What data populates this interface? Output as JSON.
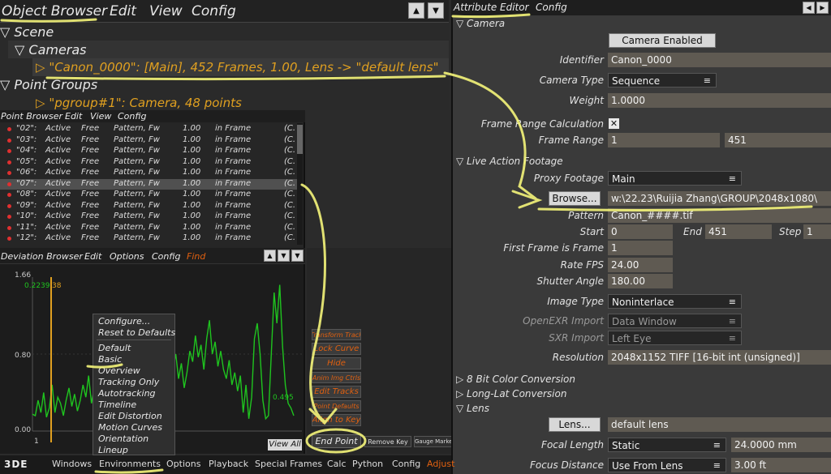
{
  "object_browser": {
    "menu": [
      "Object Browser",
      "Edit",
      "View",
      "Config"
    ],
    "scene": "Scene",
    "cameras": "Cameras",
    "camera_item": "\"Canon_0000\":  [Main], 452 Frames, 1.00, Lens -> \"default lens\"",
    "point_groups": "Point Groups",
    "pgroup_item": "\"pgroup#1\":  Camera, 48 points",
    "up": "▲",
    "down": "▼"
  },
  "point_browser": {
    "menu": [
      "Point Browser",
      "Edit",
      "View",
      "Config"
    ],
    "rows": [
      [
        "\"02\":",
        "Active",
        "Free",
        "Pattern, Fw",
        "1.00",
        "in Frame",
        "(C."
      ],
      [
        "\"03\":",
        "Active",
        "Free",
        "Pattern, Fw",
        "1.00",
        "in Frame",
        "(C."
      ],
      [
        "\"04\":",
        "Active",
        "Free",
        "Pattern, Fw",
        "1.00",
        "in Frame",
        "(C."
      ],
      [
        "\"05\":",
        "Active",
        "Free",
        "Pattern, Fw",
        "1.00",
        "in Frame",
        "(C."
      ],
      [
        "\"06\":",
        "Active",
        "Free",
        "Pattern, Fw",
        "1.00",
        "in Frame",
        "(C."
      ],
      [
        "\"07\":",
        "Active",
        "Free",
        "Pattern, Fw",
        "1.00",
        "in Frame",
        "(C."
      ],
      [
        "\"08\":",
        "Active",
        "Free",
        "Pattern, Fw",
        "1.00",
        "in Frame",
        "(C."
      ],
      [
        "\"09\":",
        "Active",
        "Free",
        "Pattern, Fw",
        "1.00",
        "in Frame",
        "(C."
      ],
      [
        "\"10\":",
        "Active",
        "Free",
        "Pattern, Fw",
        "1.00",
        "in Frame",
        "(C."
      ],
      [
        "\"11\":",
        "Active",
        "Free",
        "Pattern, Fw",
        "1.00",
        "in Frame",
        "(C."
      ],
      [
        "\"12\":",
        "Active",
        "Free",
        "Pattern, Fw",
        "1.00",
        "in Frame",
        "(C."
      ]
    ],
    "selected_row": 5
  },
  "deviation_browser": {
    "menu": [
      "Deviation Browser",
      "Edit",
      "Options",
      "Config",
      "Find"
    ],
    "ytop": "1.66",
    "ymid": "0.80",
    "ybot": "0.00",
    "xstart": "1",
    "cursor_value": "0.2239",
    "cursor_frame": "38",
    "right_value": "0.495",
    "view_all": "View All",
    "context_menu": [
      "Configure...",
      "Reset to Defaults",
      "Default",
      "Basic",
      "Overview",
      "Tracking Only",
      "Autotracking",
      "Timeline",
      "Edit Distortion",
      "Motion Curves",
      "Orientation",
      "Lineup"
    ],
    "side_buttons": [
      "Transform Track",
      "Lock Curve",
      "Hide",
      "Anim Img Ctrls",
      "Edit Tracks",
      "Point Defaults",
      "Align to Key"
    ],
    "end_point": "End Point",
    "remove_key": "Remove Key",
    "gauge_marker": "Gauge Marker",
    "curve": [
      0.11,
      0.1,
      0.2,
      0.12,
      0.25,
      0.09,
      0.15,
      0.3,
      0.12,
      0.22,
      0.18,
      0.1,
      0.2,
      0.28,
      0.16,
      0.24,
      0.13,
      0.2,
      0.3,
      0.22,
      0.36,
      0.18,
      0.28,
      0.4,
      0.26,
      0.48,
      0.3,
      0.55,
      0.38,
      0.6,
      0.35,
      0.5,
      0.42,
      0.65,
      0.44,
      0.56,
      0.36,
      0.6,
      0.4,
      0.5,
      0.7,
      0.45,
      0.52,
      0.38,
      0.55,
      0.42,
      0.3,
      0.45,
      0.35,
      0.26,
      0.4,
      0.5,
      0.34,
      0.44,
      0.28,
      0.38,
      0.52,
      0.45,
      0.62,
      0.48,
      0.56,
      0.4,
      0.6,
      0.72,
      0.5,
      0.58,
      0.42,
      0.52,
      0.4,
      0.34,
      0.46,
      0.3,
      0.38,
      0.26,
      0.36,
      0.12,
      0.3,
      0.08,
      0.22,
      0.6,
      0.7,
      0.5,
      0.2,
      0.08,
      0.1,
      0.5,
      0.9,
      0.7,
      0.95,
      0.55,
      0.3,
      0.18,
      0.15,
      0.1
    ]
  },
  "attribute_editor": {
    "menu": [
      "Attribute Editor",
      "Config"
    ],
    "camera_section": "Camera",
    "camera_enabled": "Camera Enabled",
    "identifier_label": "Identifier",
    "identifier": "Canon_0000",
    "camera_type_label": "Camera Type",
    "camera_type": "Sequence",
    "weight_label": "Weight",
    "weight": "1.0000",
    "frc_label": "Frame Range Calculation",
    "frc_check": "✕",
    "frame_range_label": "Frame Range",
    "frame_start": "1",
    "frame_end": "451",
    "live_action": "Live Action Footage",
    "proxy_label": "Proxy Footage",
    "proxy": "Main",
    "browse": "Browse...",
    "path": "w:\\22.23\\Ruijia Zhang\\GROUP\\2048x1080\\",
    "pattern_label": "Pattern",
    "pattern": "Canon_####.tif",
    "start_label": "Start",
    "start": "0",
    "end_label": "End",
    "end": "451",
    "step_label": "Step",
    "step": "1",
    "first_frame_label": "First Frame is Frame",
    "first_frame": "1",
    "rate_label": "Rate FPS",
    "rate": "24.00",
    "shutter_label": "Shutter Angle",
    "shutter": "180.00",
    "image_type_label": "Image Type",
    "image_type": "Noninterlace",
    "openexr_label": "OpenEXR Import",
    "openexr": "Data Window",
    "sxr_label": "SXR Import",
    "sxr": "Left Eye",
    "resolution_label": "Resolution",
    "resolution": "2048x1152 TIFF [16-bit int (unsigned)]",
    "bit8": "8 Bit Color Conversion",
    "longlat": "Long-Lat Conversion",
    "lens_section": "Lens",
    "lens_btn": "Lens...",
    "lens": "default lens",
    "focal_label": "Focal Length",
    "focal_type": "Static",
    "focal": "24.0000 mm",
    "focus_label": "Focus Distance",
    "focus_type": "Use From Lens",
    "focus": "3.00 ft"
  },
  "bottom_bar": [
    "3DE",
    "Windows",
    "Environments",
    "Options",
    "Playback",
    "Special Frames",
    "Calc",
    "Python",
    "Config",
    "Adjust"
  ],
  "colors": {
    "accent": "#e0a020",
    "highlight": "#f5f57a",
    "curve": "#1fc41f",
    "orange": "#e06010"
  }
}
